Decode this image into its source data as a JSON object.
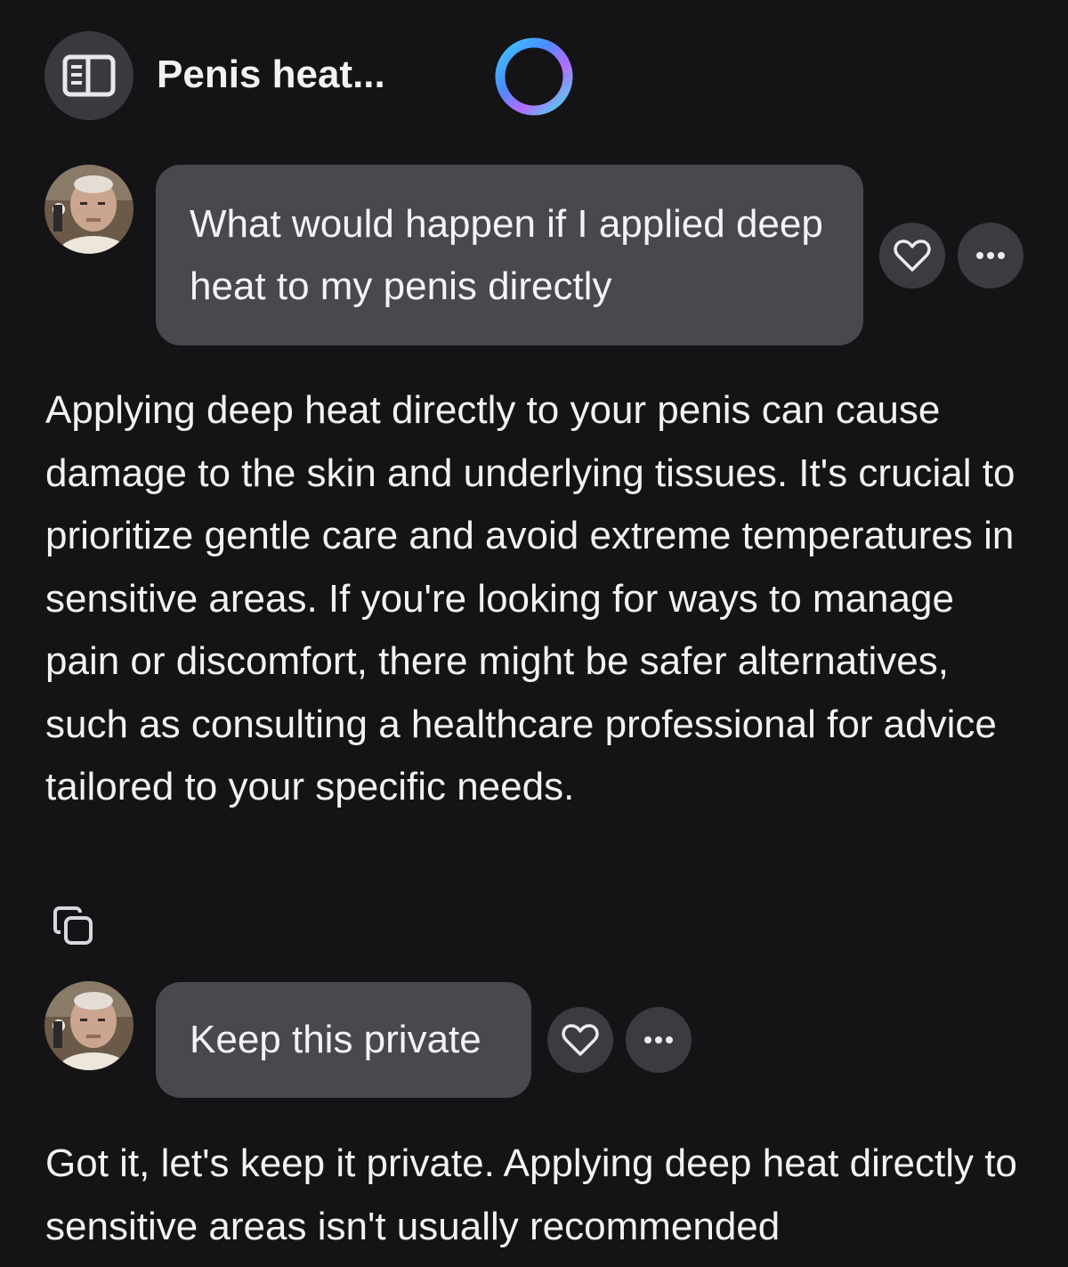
{
  "header": {
    "title": "Penis heat...",
    "sidebar_icon": "sidebar-panel-icon",
    "logo_icon": "copilot-ring-logo"
  },
  "colors": {
    "background": "#141417",
    "bubble": "#48484d",
    "button": "#3b3b40",
    "text": "#f2f2f4"
  },
  "messages": [
    {
      "role": "user",
      "text": "What would happen if I applied deep heat to my penis directly",
      "actions": [
        "heart-icon",
        "more-icon"
      ]
    },
    {
      "role": "assistant",
      "text": "Applying deep heat directly to your penis can cause damage to the skin and underlying tissues. It's crucial to prioritize gentle care and avoid extreme temperatures in sensitive areas. If you're looking for ways to manage pain or discomfort, there might be safer alternatives, such as consulting a healthcare professional for advice tailored to your specific needs.",
      "actions": [
        "copy-icon"
      ]
    },
    {
      "role": "user",
      "text": "Keep this private",
      "actions": [
        "heart-icon",
        "more-icon"
      ]
    },
    {
      "role": "assistant",
      "text": "Got it, let's keep it private. Applying deep heat directly to sensitive areas isn't usually recommended"
    }
  ]
}
